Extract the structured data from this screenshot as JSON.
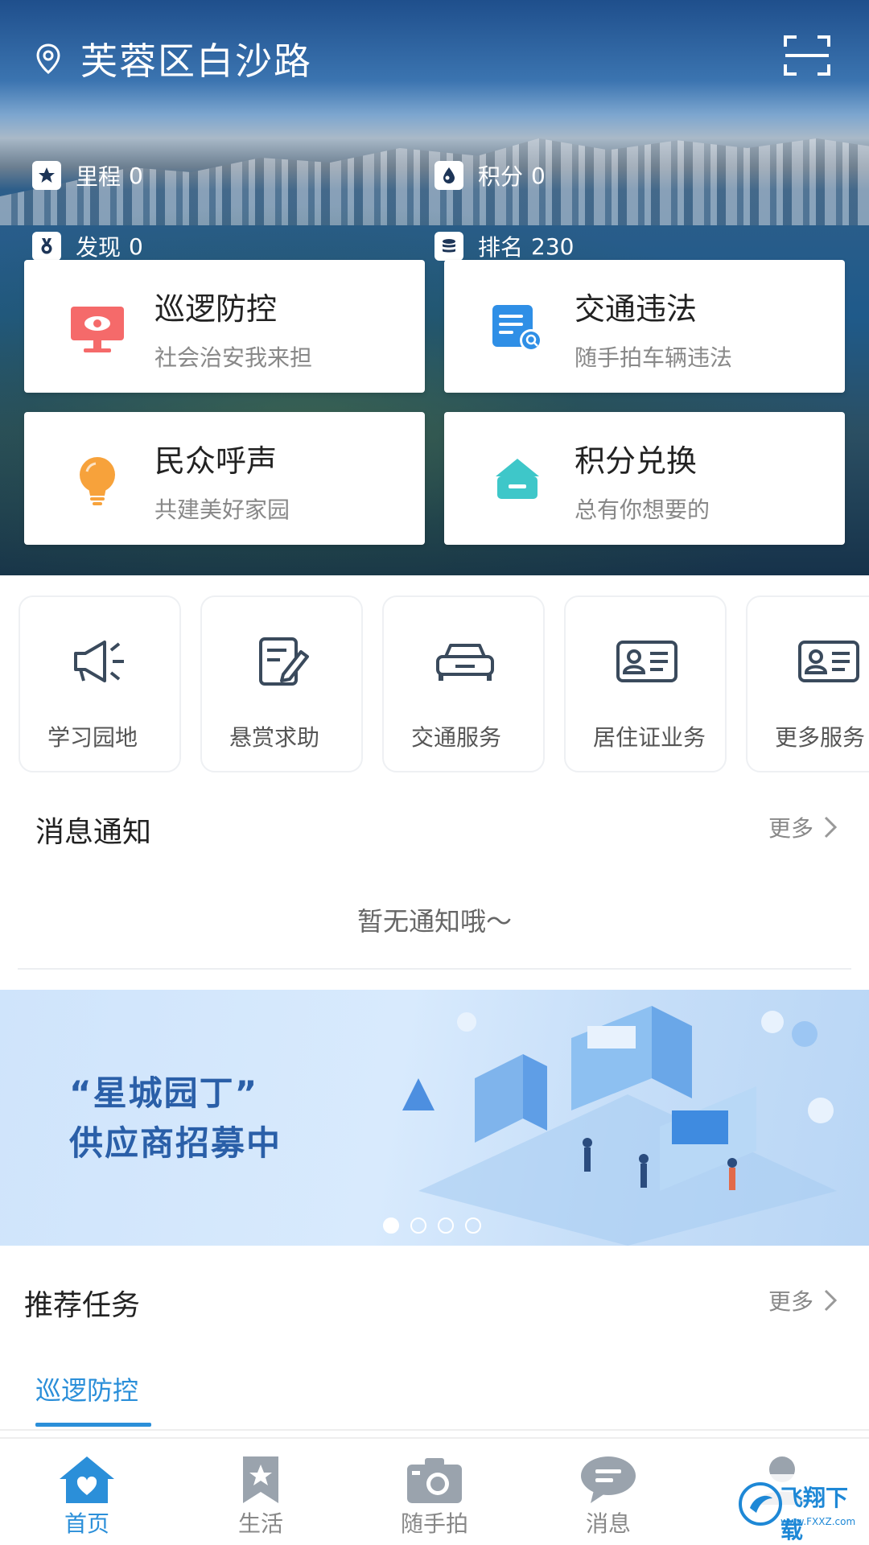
{
  "hero": {
    "location": "芙蓉区白沙路",
    "stats": [
      {
        "label": "里程",
        "value": "0",
        "icon": "star-icon"
      },
      {
        "label": "积分",
        "value": "0",
        "icon": "drop-icon"
      },
      {
        "label": "发现",
        "value": "0",
        "icon": "medal-icon"
      },
      {
        "label": "排名",
        "value": "230",
        "icon": "coins-icon"
      }
    ],
    "cards": [
      {
        "title": "巡逻防控",
        "subtitle": "社会治安我来担",
        "icon": "monitor-eye-icon"
      },
      {
        "title": "交通违法",
        "subtitle": "随手拍车辆违法",
        "icon": "document-search-icon"
      },
      {
        "title": "民众呼声",
        "subtitle": "共建美好家园",
        "icon": "lightbulb-icon"
      },
      {
        "title": "积分兑换",
        "subtitle": "总有你想要的",
        "icon": "basket-icon"
      }
    ]
  },
  "services": [
    {
      "label": "学习园地",
      "icon": "megaphone-icon"
    },
    {
      "label": "悬赏求助",
      "icon": "edit-document-icon"
    },
    {
      "label": "交通服务",
      "icon": "car-icon"
    },
    {
      "label": "居住证业务",
      "icon": "id-card-icon"
    },
    {
      "label": "更多服务",
      "icon": "id-card-icon"
    }
  ],
  "notice": {
    "title": "消息通知",
    "more": "更多",
    "empty": "暂无通知哦～"
  },
  "banner": {
    "line1": "“星城园丁”",
    "line2": "供应商招募中",
    "active_dot": 0,
    "dot_count": 4
  },
  "recommended": {
    "title": "推荐任务",
    "more": "更多",
    "active_tab": "巡逻防控"
  },
  "nav": [
    {
      "label": "首页",
      "icon": "home-heart-icon",
      "active": true
    },
    {
      "label": "生活",
      "icon": "bookmark-star-icon",
      "active": false
    },
    {
      "label": "随手拍",
      "icon": "camera-icon",
      "active": false
    },
    {
      "label": "消息",
      "icon": "chat-bubble-icon",
      "active": false
    },
    {
      "label": "",
      "icon": "user-icon",
      "active": false
    }
  ],
  "watermark": {
    "title": "飞翔下载",
    "url": "www.FXXZ.com"
  },
  "colors": {
    "accent": "#2b8fd9",
    "banner_text": "#2a5fa8",
    "nav_inactive": "#888888"
  }
}
